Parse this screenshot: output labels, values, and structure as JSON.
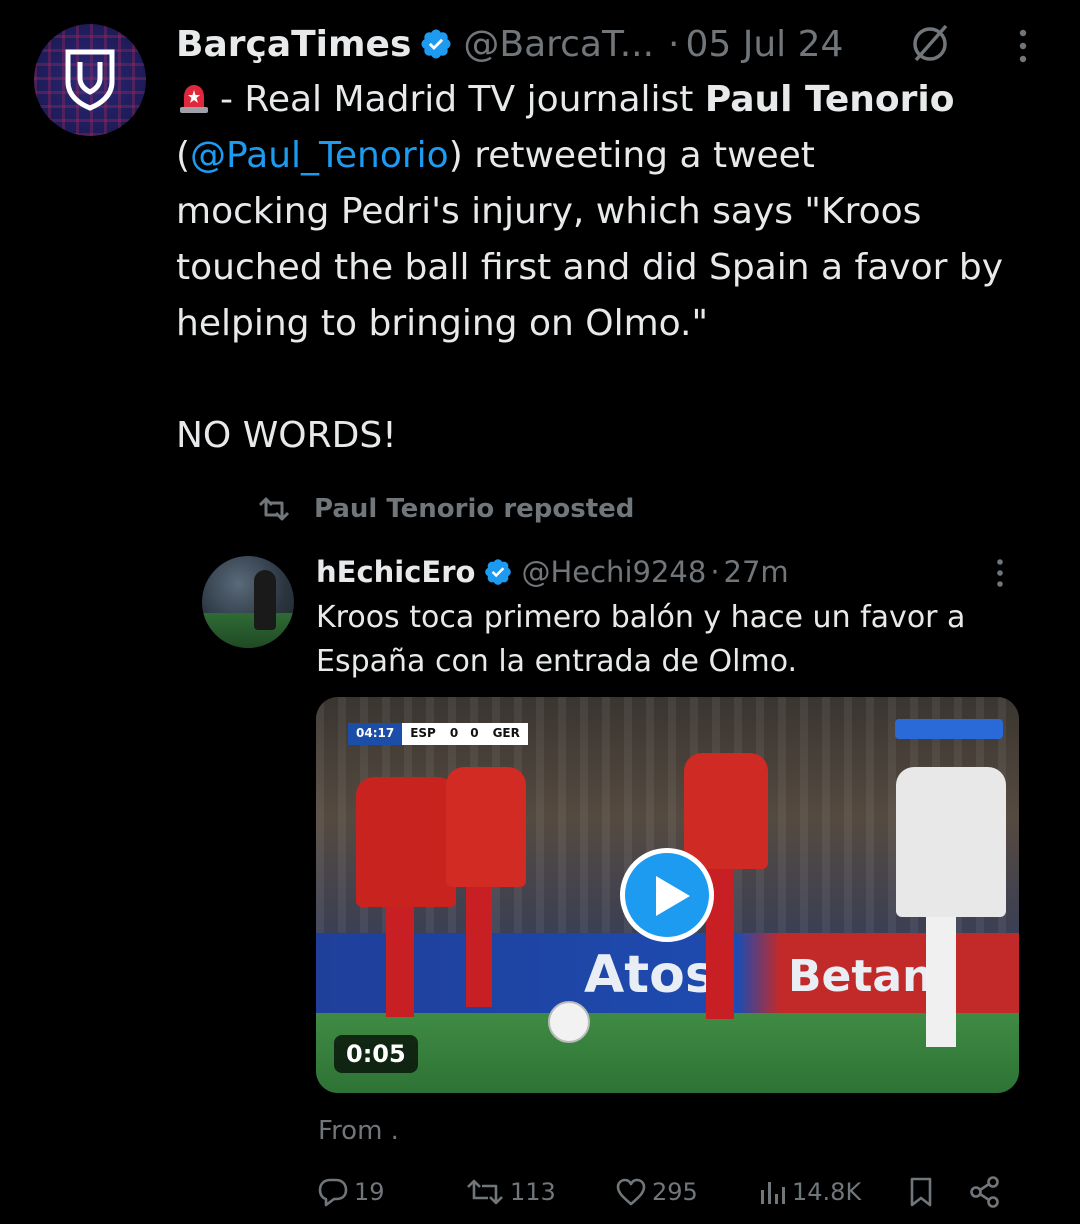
{
  "author": {
    "name": "BarçaTimes",
    "handle": "@BarcaT...",
    "date": "05 Jul 24"
  },
  "tweet": {
    "line1_prefix": "- Real Madrid TV journalist ",
    "line1_bold": "Paul Tenorio",
    "line2_open": "(",
    "line2_mention": "@Paul_Tenorio",
    "line2_rest": ") retweeting a tweet",
    "line3": "mocking Pedri's injury, which says \"Kroos",
    "line4": "touched the ball first and did Spain a favor by",
    "line5": "helping to bringing on Olmo.\"",
    "line6": "NO WORDS!"
  },
  "repost": {
    "label": "Paul Tenorio reposted"
  },
  "quoted": {
    "name": "hEchicEro",
    "handle": "@Hechi9248",
    "time": "27m",
    "line1": "Kroos toca primero balón y hace un favor a",
    "line2": "España con la entrada de Olmo.",
    "video": {
      "duration": "0:05",
      "scorebug": {
        "clock": "04:17",
        "home": "ESP",
        "home_score": "0",
        "away_score": "0",
        "away": "GER"
      },
      "board_text_left": "Atos",
      "board_text_right": "Betan"
    }
  },
  "footer": {
    "from": "From ."
  },
  "actions": {
    "replies": "19",
    "reposts": "113",
    "likes": "295",
    "views": "14.8K"
  },
  "colors": {
    "background": "#000000",
    "text": "#e7e9ea",
    "muted": "#71767b",
    "accent": "#1d9bf0"
  },
  "icons": [
    "verified-icon",
    "grok-icon",
    "more-icon",
    "siren-emoji",
    "repost-icon",
    "play-icon",
    "reply-icon",
    "like-icon",
    "views-icon",
    "bookmark-icon",
    "share-icon"
  ]
}
